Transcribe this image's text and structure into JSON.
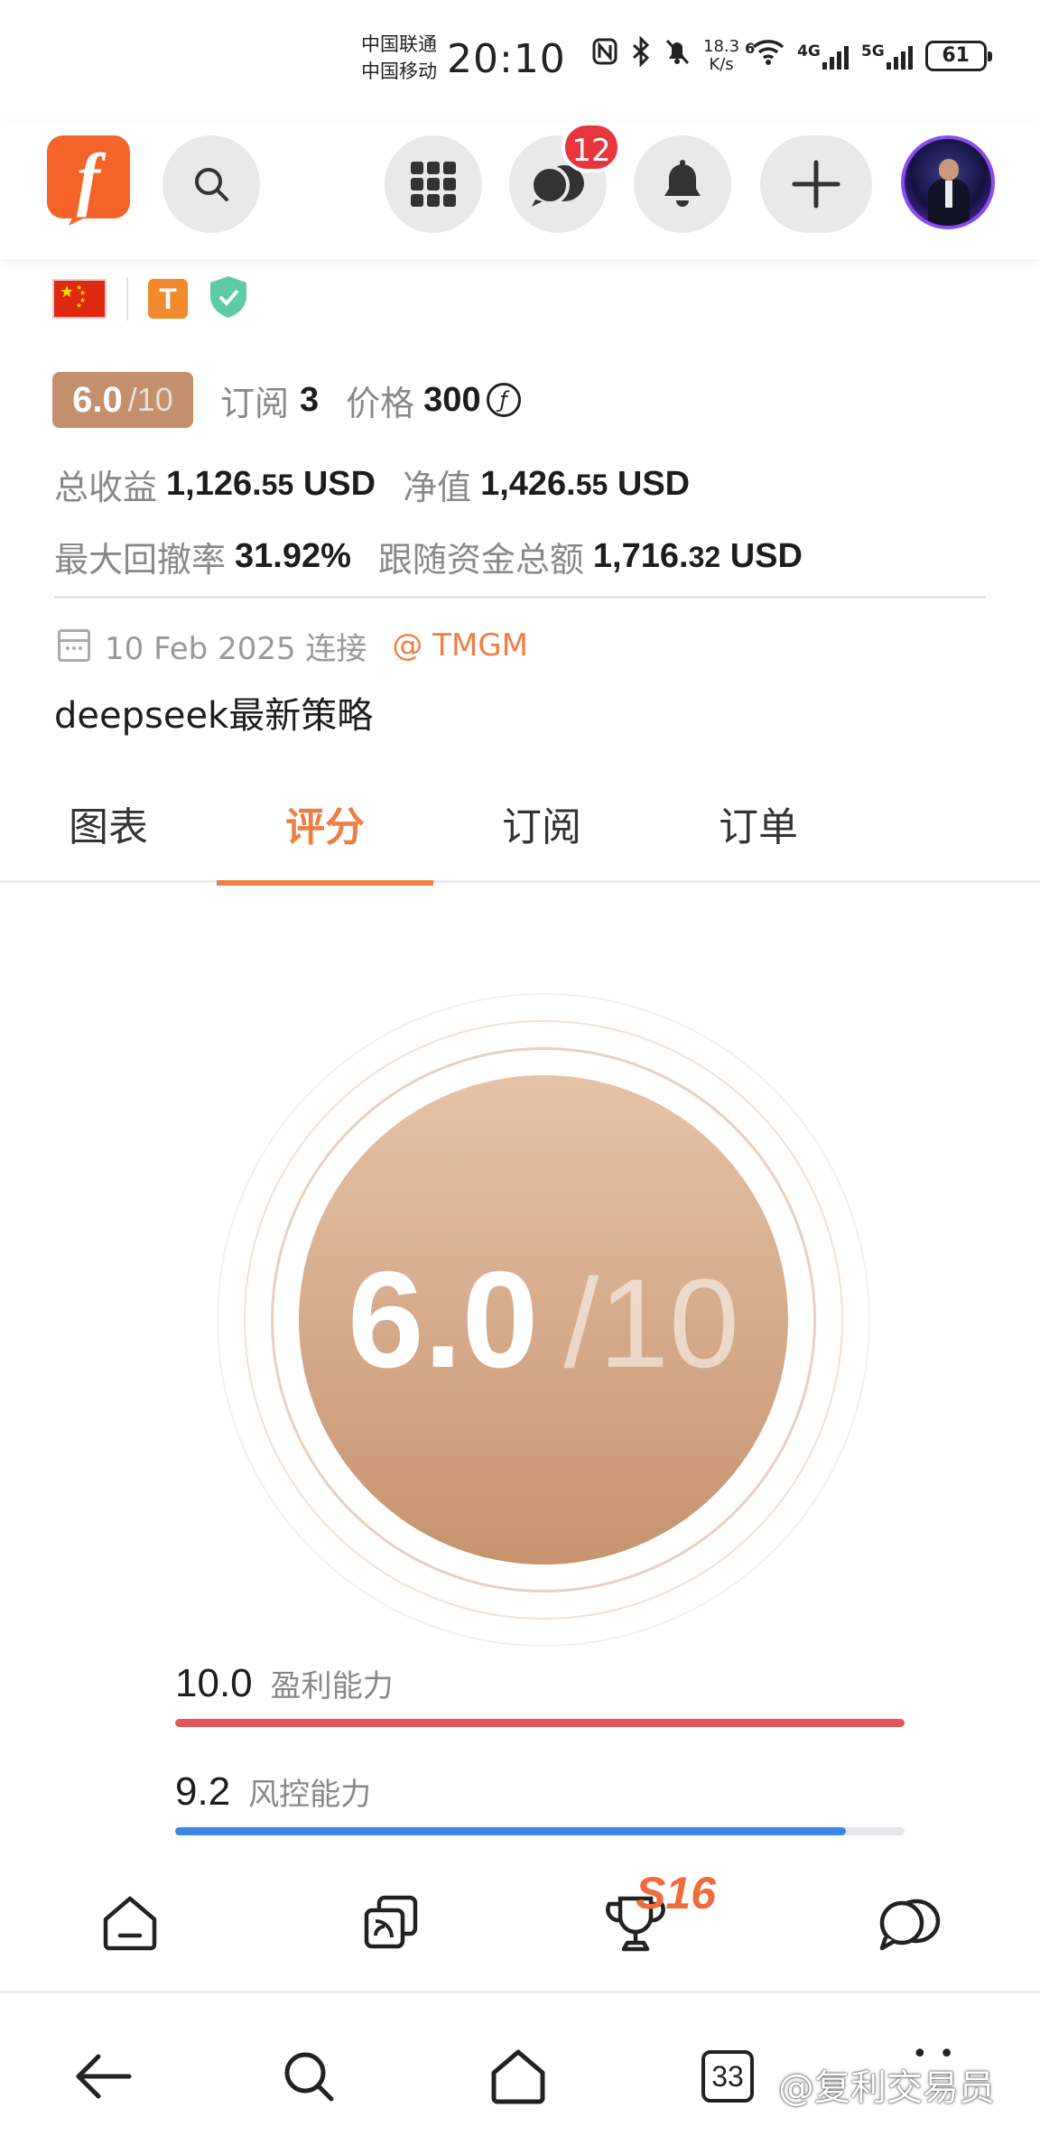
{
  "status_bar": {
    "carrier1": "中国联通",
    "carrier2": "中国移动",
    "time": "20:10",
    "net_speed_value": "18.3",
    "net_speed_unit": "K/s",
    "wifi_tag": "6",
    "net1": "4G",
    "net2": "5G",
    "battery": "61"
  },
  "header": {
    "logo_letter": "f",
    "messages_badge": "12",
    "icons": [
      "search-icon",
      "apps-grid-icon",
      "chat-icon",
      "bell-icon",
      "plus-icon"
    ]
  },
  "profile": {
    "t_badge": "T",
    "score": "6.0",
    "score_max": "/10",
    "subscribe_label": "订阅",
    "subscribe_count": "3",
    "price_label": "价格",
    "price_value": "300",
    "coin_symbol": "ƒ",
    "total_profit_label": "总收益",
    "total_profit_main": "1,126.",
    "total_profit_cents": "55",
    "total_profit_unit": " USD",
    "net_value_label": "净值",
    "net_value_main": "1,426.",
    "net_value_cents": "55",
    "net_value_unit": " USD",
    "max_drawdown_label": "最大回撤率",
    "max_drawdown_value": "31.92%",
    "follow_total_label": "跟随资金总额",
    "follow_total_main": "1,716.",
    "follow_total_cents": "32",
    "follow_total_unit": " USD",
    "connected_date": "10 Feb 2025 连接",
    "broker": "@ TMGM",
    "strategy_name": "deepseek最新策略"
  },
  "tabs": [
    {
      "label": "图表"
    },
    {
      "label": "评分"
    },
    {
      "label": "订阅"
    },
    {
      "label": "订单"
    }
  ],
  "active_tab": "评分",
  "rating": {
    "score": "6.0",
    "score_max": "/10",
    "metrics": [
      {
        "value": "10.0",
        "label": "盈利能力",
        "fraction": 1.0,
        "color": "#e0545b"
      },
      {
        "value": "9.2",
        "label": "风控能力",
        "fraction": 0.92,
        "color": "#3d85e6"
      }
    ]
  },
  "bottom_nav": {
    "items": [
      "home-icon",
      "copy-trade-icon",
      "trophy-icon",
      "chat-icon"
    ],
    "promo_text": "S16"
  },
  "system_nav": {
    "tab_count": "33",
    "watermark": "@复利交易员"
  },
  "colors": {
    "accent": "#ef7e44",
    "score_bronze": "#c48f6d",
    "badge_red": "#e8363e"
  }
}
